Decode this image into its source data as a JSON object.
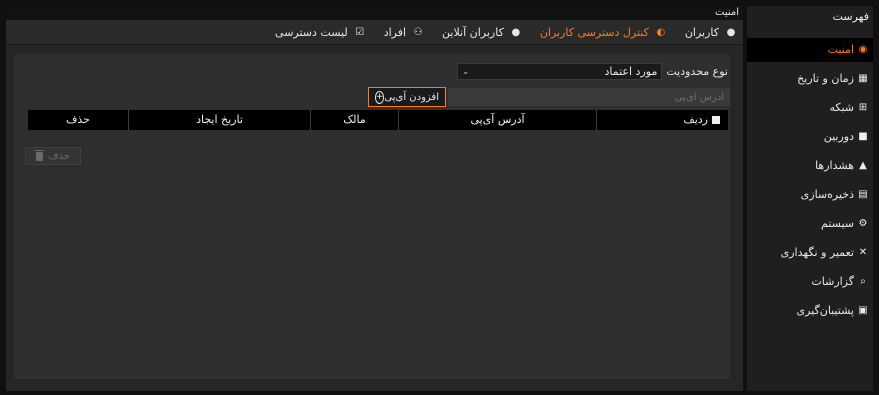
{
  "sidebar": {
    "title": "فهرست",
    "items": [
      {
        "label": "امنیت",
        "icon": "◉",
        "icon_name": "security-icon",
        "active": true
      },
      {
        "label": "زمان و تاریخ",
        "icon": "▦",
        "icon_name": "calendar-icon",
        "active": false
      },
      {
        "label": "شبکه",
        "icon": "⊞",
        "icon_name": "network-icon",
        "active": false
      },
      {
        "label": "دوربین",
        "icon": "■",
        "icon_name": "camera-icon",
        "active": false
      },
      {
        "label": "هشدارها",
        "icon": "▲",
        "icon_name": "alarm-bell-icon",
        "active": false
      },
      {
        "label": "ذخیره‌سازی",
        "icon": "▤",
        "icon_name": "storage-icon",
        "active": false
      },
      {
        "label": "سیستم",
        "icon": "⚙",
        "icon_name": "system-gear-icon",
        "active": false
      },
      {
        "label": "تعمیر و نگهداری",
        "icon": "✕",
        "icon_name": "maintenance-tools-icon",
        "active": false
      },
      {
        "label": "گزارشات",
        "icon": "⌕",
        "icon_name": "reports-icon",
        "active": false
      },
      {
        "label": "پشتیبان‌گیری",
        "icon": "▣",
        "icon_name": "backup-icon",
        "active": false
      }
    ]
  },
  "main": {
    "title": "امنیت",
    "tabs": [
      {
        "label": "کاربران",
        "icon": "●",
        "icon_name": "user-icon",
        "active": false
      },
      {
        "label": "کنترل دسترسی کاربران",
        "icon": "◐",
        "icon_name": "access-control-icon",
        "active": true
      },
      {
        "label": "کاربران آنلاین",
        "icon": "●",
        "icon_name": "online-dot-icon",
        "active": false
      },
      {
        "label": "افراد",
        "icon": "⚇",
        "icon_name": "people-icon",
        "active": false
      },
      {
        "label": "لیست دسترسی",
        "icon": "☑",
        "icon_name": "checklist-icon",
        "active": false
      }
    ],
    "filter": {
      "label": "نوع محدودیت",
      "value": "مورد اعتماد"
    },
    "ip": {
      "placeholder": "آدرس آی‌پی",
      "add_label": "افزودن آی‌پی"
    },
    "table": {
      "headers": {
        "row": "ردیف",
        "ip": "آدرس آی‌پی",
        "owner": "مالک",
        "date": "تاریخ ایجاد",
        "delete": "حذف"
      }
    },
    "delete_label": "حذف"
  },
  "colors": {
    "accent": "#ff7a1a",
    "panel": "#262626",
    "sidebar": "#1f1f1f"
  }
}
